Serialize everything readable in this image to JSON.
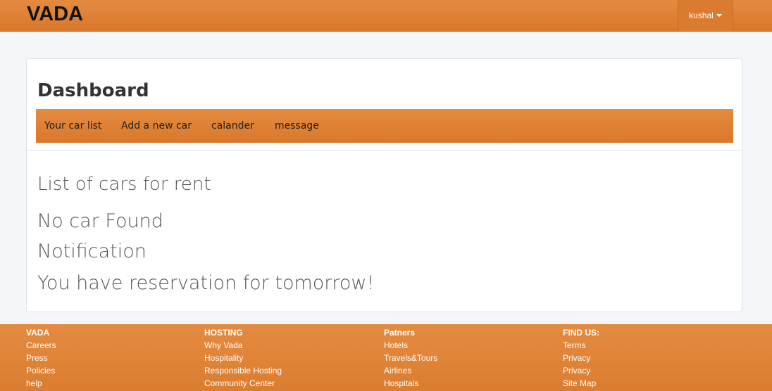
{
  "navbar": {
    "brand": "VADA",
    "user": "kushal"
  },
  "dashboard": {
    "title": "Dashboard",
    "tabs": [
      "Your car list",
      "Add a new car",
      "calander",
      "message"
    ],
    "lines": [
      "List of cars for rent",
      "No car Found",
      "Notification",
      "You have reservation for tomorrow!"
    ]
  },
  "footer": {
    "columns": [
      {
        "heading": "VADA",
        "links": [
          "Careers",
          "Press",
          "Policies",
          "help"
        ]
      },
      {
        "heading": "HOSTING",
        "links": [
          "Why Vada",
          "Hospitality",
          "Responsible Hosting",
          "Community Center"
        ]
      },
      {
        "heading": "Patners",
        "links": [
          "Hotels",
          "Travels&Tours",
          "Airlines",
          "Hospitals"
        ]
      },
      {
        "heading": "FIND US:",
        "links": [
          "Terms",
          "Privacy",
          "Privacy",
          "Site Map"
        ]
      }
    ]
  },
  "colors": {
    "accent": "#de8236",
    "background": "#f4f6f9"
  }
}
